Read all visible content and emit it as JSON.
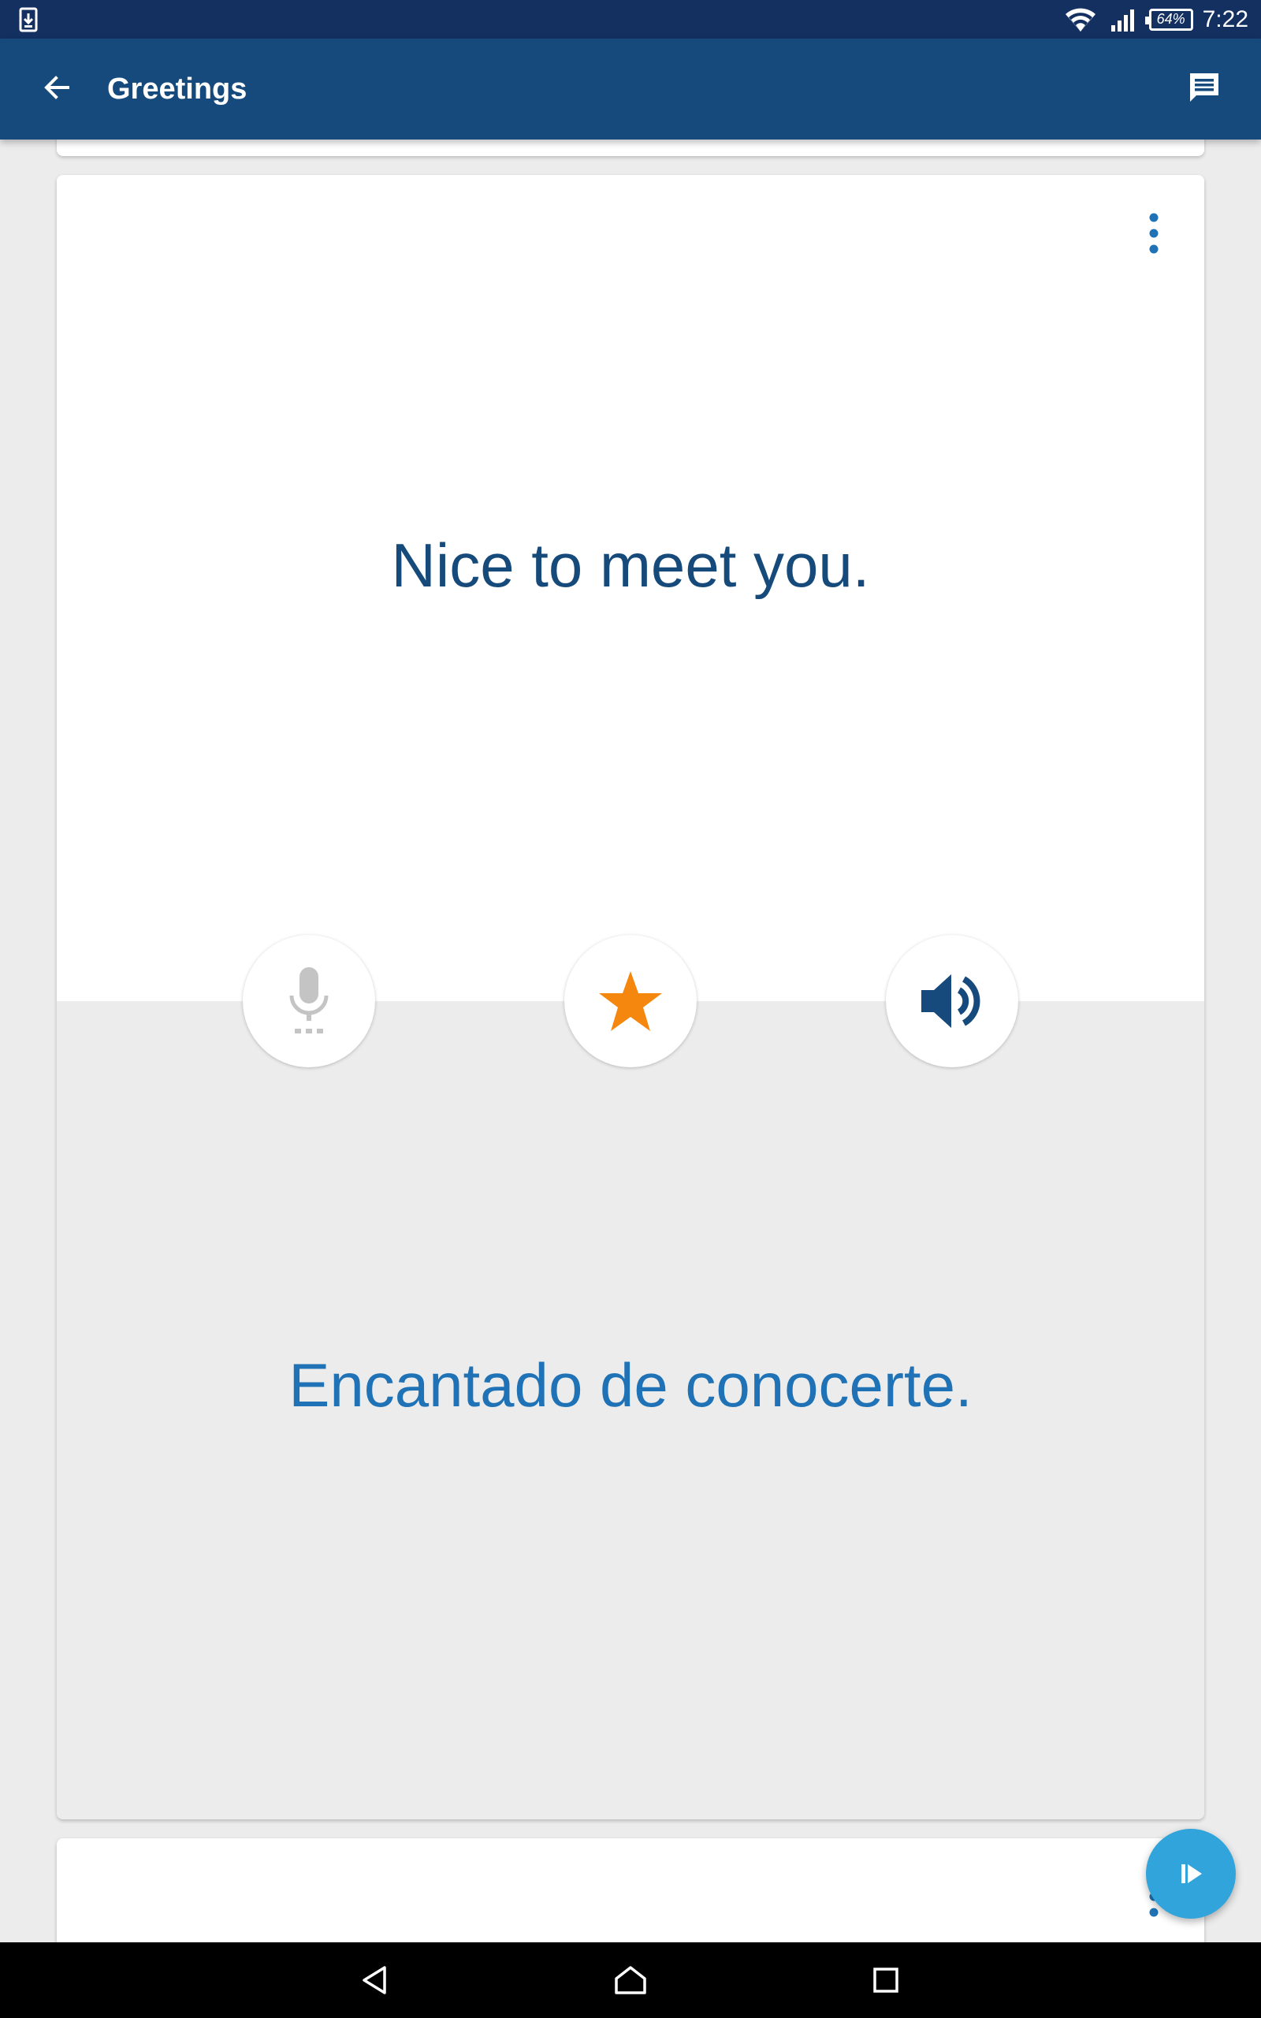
{
  "status_bar": {
    "time": "7:22",
    "battery": "64%",
    "icons": [
      "screenshot-icon",
      "wifi-icon",
      "signal-icon",
      "battery-icon"
    ]
  },
  "app_bar": {
    "title": "Greetings",
    "back_icon": "arrow-left-icon",
    "action_icon": "chat-icon"
  },
  "card": {
    "phrase": "Nice to meet you.",
    "translation": "Encantado de conocerte.",
    "menu_icon": "more-vert-icon",
    "actions": [
      {
        "name": "microphone",
        "icon": "mic-icon",
        "enabled": false
      },
      {
        "name": "favorite",
        "icon": "star-icon",
        "enabled": true
      },
      {
        "name": "speak",
        "icon": "speaker-icon",
        "enabled": true
      }
    ]
  },
  "fab": {
    "icon": "play-icon"
  },
  "nav_bar": {
    "icons": [
      "nav-back-icon",
      "nav-home-icon",
      "nav-recents-icon"
    ]
  },
  "colors": {
    "status_bar": "#133060",
    "app_bar": "#164a7c",
    "phrase_text": "#154a7a",
    "translation_text": "#1f72b5",
    "star": "#f5870f",
    "fab": "#31a4dc",
    "background": "#ececec"
  }
}
